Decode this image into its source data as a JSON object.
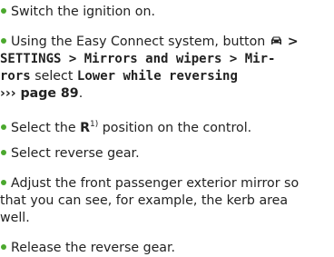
{
  "steps": [
    {
      "text": "Switch the ignition on."
    },
    {
      "line1_prefix": "Using the Easy Connect system, button",
      "line1_icon": "car-menu-icon",
      "line1_sep": " >",
      "line2": "SETTINGS > Mirrors and wipers > Mir-",
      "line3_code_a": "rors",
      "line3_mid": " select ",
      "line3_code_b": "Lower while reversing",
      "line4_ref_arrow": "›››",
      "line4_ref": " page 89",
      "line4_end": "."
    },
    {
      "prefix": "Select the ",
      "bold": "R",
      "sup": "1)",
      "suffix": " position on the control."
    },
    {
      "text": "Select reverse gear."
    },
    {
      "line1": "Adjust the front passenger exterior mirror so",
      "line2": "that you can see, for example, the kerb area",
      "line3": "well."
    },
    {
      "text": "Release the reverse gear."
    }
  ],
  "colors": {
    "bullet": "#4ba82e",
    "text": "#222222"
  }
}
